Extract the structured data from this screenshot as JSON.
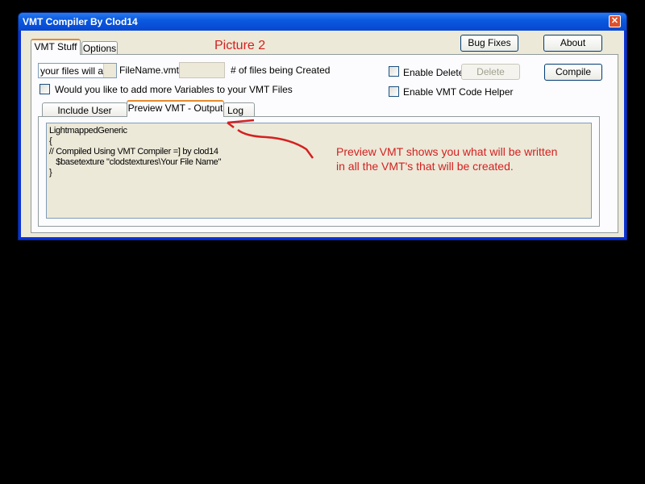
{
  "window": {
    "title": "VMT Compiler By Clod14",
    "close_icon": "close-icon"
  },
  "annotations": {
    "picture_label": "Picture 2",
    "note_line1": "Preview VMT shows you what will be written",
    "note_line2": "in all the VMT's that will be created.",
    "color": "#d42020"
  },
  "top_buttons": {
    "bug_fixes": "Bug Fixes",
    "about": "About"
  },
  "main_tabs": [
    {
      "label": "VMT Stuff",
      "selected": true
    },
    {
      "label": "Options",
      "selected": false
    }
  ],
  "vmt_stuff": {
    "filename_input": "your files will ap",
    "filename_suffix": "FileName.vmt",
    "count_input": "",
    "count_label": "# of files being Created",
    "more_vars_label": "Would you like to add more Variables to your VMT Files",
    "enable_delete_label": "Enable Delete",
    "delete_button": "Delete",
    "compile_button": "Compile",
    "code_helper_label": "Enable VMT Code Helper"
  },
  "sub_tabs": [
    {
      "label": "Include User Coding",
      "selected": false
    },
    {
      "label": "Preview VMT - Output",
      "selected": true
    },
    {
      "label": "Log",
      "selected": false
    }
  ],
  "preview_text": "LightmappedGeneric\n{\n// Compiled Using VMT Compiler =] by clod14\n   $basetexture \"clodstextures\\Your File Name\"\n}"
}
